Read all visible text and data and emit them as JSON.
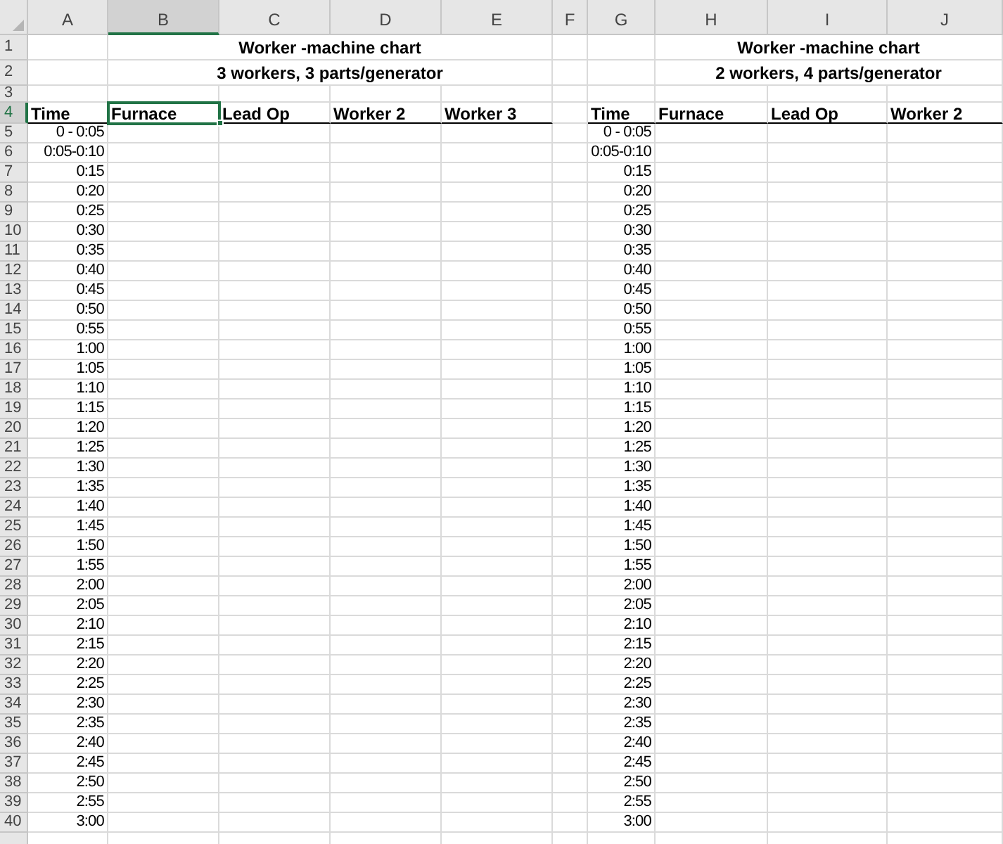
{
  "column_headers": [
    {
      "label": "A",
      "selected": false
    },
    {
      "label": "B",
      "selected": true
    },
    {
      "label": "C",
      "selected": false
    },
    {
      "label": "D",
      "selected": false
    },
    {
      "label": "E",
      "selected": false
    },
    {
      "label": "F",
      "selected": false
    },
    {
      "label": "G",
      "selected": false
    },
    {
      "label": "H",
      "selected": false
    },
    {
      "label": "I",
      "selected": false
    },
    {
      "label": "J",
      "selected": false
    }
  ],
  "row_headers": [
    {
      "label": "1",
      "selected": false
    },
    {
      "label": "2",
      "selected": false
    },
    {
      "label": "3",
      "selected": false
    },
    {
      "label": "4",
      "selected": true
    },
    {
      "label": "5",
      "selected": false
    },
    {
      "label": "6",
      "selected": false
    },
    {
      "label": "7",
      "selected": false
    },
    {
      "label": "8",
      "selected": false
    },
    {
      "label": "9",
      "selected": false
    },
    {
      "label": "10",
      "selected": false
    },
    {
      "label": "11",
      "selected": false
    },
    {
      "label": "12",
      "selected": false
    },
    {
      "label": "13",
      "selected": false
    },
    {
      "label": "14",
      "selected": false
    },
    {
      "label": "15",
      "selected": false
    },
    {
      "label": "16",
      "selected": false
    },
    {
      "label": "17",
      "selected": false
    },
    {
      "label": "18",
      "selected": false
    },
    {
      "label": "19",
      "selected": false
    },
    {
      "label": "20",
      "selected": false
    },
    {
      "label": "21",
      "selected": false
    },
    {
      "label": "22",
      "selected": false
    },
    {
      "label": "23",
      "selected": false
    },
    {
      "label": "24",
      "selected": false
    },
    {
      "label": "25",
      "selected": false
    },
    {
      "label": "26",
      "selected": false
    },
    {
      "label": "27",
      "selected": false
    },
    {
      "label": "28",
      "selected": false
    },
    {
      "label": "29",
      "selected": false
    },
    {
      "label": "30",
      "selected": false
    },
    {
      "label": "31",
      "selected": false
    },
    {
      "label": "32",
      "selected": false
    },
    {
      "label": "33",
      "selected": false
    },
    {
      "label": "34",
      "selected": false
    },
    {
      "label": "35",
      "selected": false
    },
    {
      "label": "36",
      "selected": false
    },
    {
      "label": "37",
      "selected": false
    },
    {
      "label": "38",
      "selected": false
    },
    {
      "label": "39",
      "selected": false
    },
    {
      "label": "40",
      "selected": false
    }
  ],
  "tables": [
    {
      "title": "Worker -machine chart",
      "subtitle": "3 workers, 3 parts/generator",
      "headers": [
        {
          "label": "Time",
          "selected": false
        },
        {
          "label": "Furnace",
          "selected": true
        },
        {
          "label": "Lead Op",
          "selected": false
        },
        {
          "label": "Worker 2",
          "selected": false
        },
        {
          "label": "Worker 3",
          "selected": false
        }
      ],
      "times": [
        "0 - 0:05",
        "0:05-0:10",
        "0:15",
        "0:20",
        "0:25",
        "0:30",
        "0:35",
        "0:40",
        "0:45",
        "0:50",
        "0:55",
        "1:00",
        "1:05",
        "1:10",
        "1:15",
        "1:20",
        "1:25",
        "1:30",
        "1:35",
        "1:40",
        "1:45",
        "1:50",
        "1:55",
        "2:00",
        "2:05",
        "2:10",
        "2:15",
        "2:20",
        "2:25",
        "2:30",
        "2:35",
        "2:40",
        "2:45",
        "2:50",
        "2:55",
        "3:00"
      ]
    },
    {
      "title": "Worker -machine chart",
      "subtitle": "2 workers, 4 parts/generator",
      "headers": [
        {
          "label": "Time",
          "selected": false
        },
        {
          "label": "Furnace",
          "selected": false
        },
        {
          "label": "Lead Op",
          "selected": false
        },
        {
          "label": "Worker 2",
          "selected": false
        }
      ],
      "times": [
        "0 - 0:05",
        "0:05-0:10",
        "0:15",
        "0:20",
        "0:25",
        "0:30",
        "0:35",
        "0:40",
        "0:45",
        "0:50",
        "0:55",
        "1:00",
        "1:05",
        "1:10",
        "1:15",
        "1:20",
        "1:25",
        "1:30",
        "1:35",
        "1:40",
        "1:45",
        "1:50",
        "1:55",
        "2:00",
        "2:05",
        "2:10",
        "2:15",
        "2:20",
        "2:25",
        "2:30",
        "2:35",
        "2:40",
        "2:45",
        "2:50",
        "2:55",
        "3:00"
      ]
    }
  ]
}
